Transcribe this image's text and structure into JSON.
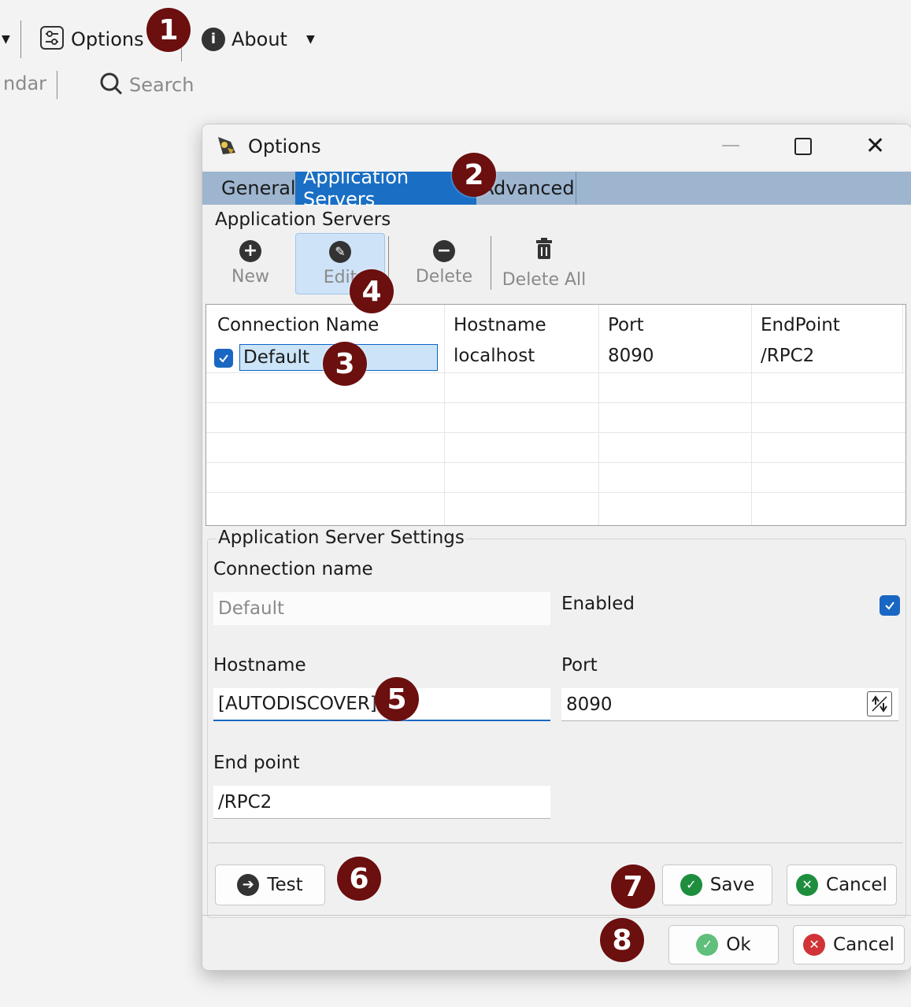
{
  "toolbar": {
    "options_label": "Options",
    "about_label": "About",
    "calendar_partial": "ndar",
    "search_label": "Search"
  },
  "dialog": {
    "title": "Options",
    "tabs": [
      "General",
      "Application Servers",
      "Advanced"
    ],
    "servers_group_label": "Application Servers",
    "actions": {
      "new": "New",
      "edit": "Edit",
      "delete": "Delete",
      "delete_all": "Delete All"
    },
    "table": {
      "headers": [
        "Connection Name",
        "Hostname",
        "Port",
        "EndPoint"
      ],
      "rows": [
        {
          "enabled": true,
          "name": "Default",
          "hostname": "localhost",
          "port": "8090",
          "endpoint": "/RPC2"
        }
      ]
    },
    "settings": {
      "group_label": "Application Server Settings",
      "connection_name_label": "Connection name",
      "connection_name_value": "Default",
      "enabled_label": "Enabled",
      "enabled": true,
      "hostname_label": "Hostname",
      "hostname_value": "[AUTODISCOVER]",
      "port_label": "Port",
      "port_value": "8090",
      "endpoint_label": "End point",
      "endpoint_value": "/RPC2"
    },
    "buttons": {
      "test": "Test",
      "save": "Save",
      "cancel_settings": "Cancel",
      "ok": "Ok",
      "cancel": "Cancel"
    }
  },
  "callouts": [
    "1",
    "2",
    "3",
    "4",
    "5",
    "6",
    "7",
    "8"
  ],
  "colors": {
    "tab_bar": "#9db5cf",
    "active_tab": "#1a6fc4",
    "accent": "#1967c2",
    "badge": "#6b0f0f",
    "save_green": "#1e8e3e",
    "cancel_red": "#d13438"
  },
  "icons": [
    "options-icon",
    "info-icon",
    "search-icon",
    "app-icon",
    "plus-icon",
    "pencil-icon",
    "minus-icon",
    "trash-icon",
    "test-arrow-icon",
    "check-icon",
    "x-icon",
    "spinner-icon"
  ]
}
